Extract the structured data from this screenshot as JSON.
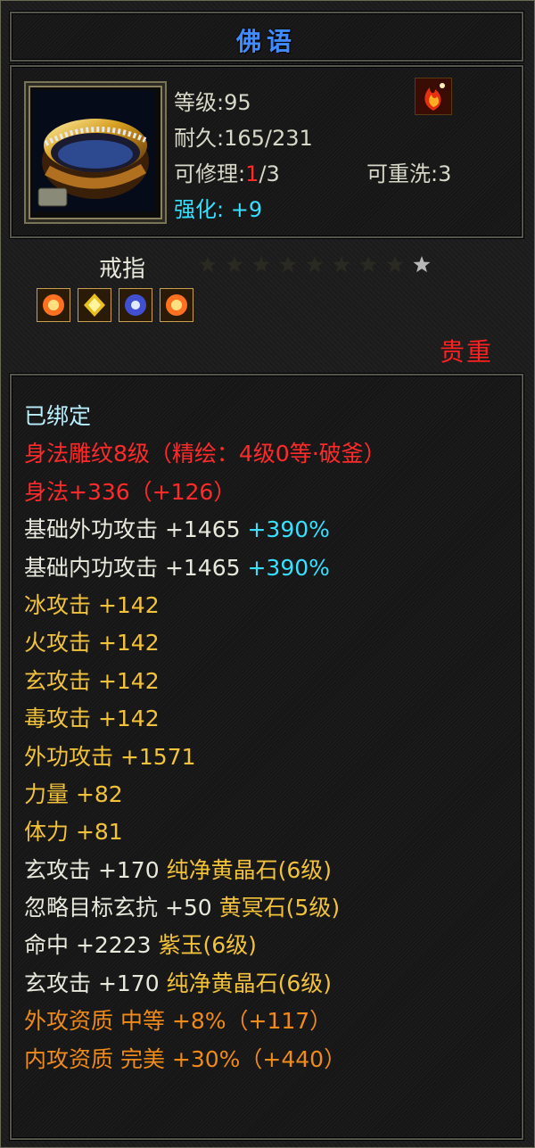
{
  "title": "佛语",
  "info": {
    "level": "等级:95",
    "durability": "耐久:165/231",
    "repair_label": "可修理:",
    "repair_used": "1",
    "repair_total": "/3",
    "rewash": "可重洗:3",
    "enhance_label": "强化:",
    "enhance_value": "+9"
  },
  "item_type": "戒指",
  "stars": {
    "filled": 8,
    "total": 9
  },
  "gems": [
    "fire-gem-icon",
    "gold-gem-icon",
    "blue-gem-icon",
    "fire-gem-icon"
  ],
  "rarity": "贵重",
  "attributes": [
    {
      "text": "已绑定",
      "color": "cyanw"
    },
    {
      "text": "身法雕纹8级（精绘：4级0等·破釜）",
      "color": "red"
    },
    {
      "text": "身法+336（+126）",
      "color": "red"
    },
    {
      "text": "基础外功攻击 +1465 ",
      "extra": "+390%",
      "color": "white"
    },
    {
      "text": "基础内功攻击 +1465 ",
      "extra": "+390%",
      "color": "white"
    },
    {
      "text": "冰攻击 +142",
      "color": "yellow"
    },
    {
      "text": "火攻击 +142",
      "color": "yellow"
    },
    {
      "text": "玄攻击 +142",
      "color": "yellow"
    },
    {
      "text": "毒攻击 +142",
      "color": "yellow"
    },
    {
      "text": "外功攻击 +1571",
      "color": "yellow"
    },
    {
      "text": "力量 +82",
      "color": "yellow"
    },
    {
      "text": "体力 +81",
      "color": "yellow"
    },
    {
      "text": "玄攻击 +170 ",
      "extra": "纯净黄晶石(6级)",
      "color": "white",
      "extra_color": "gold"
    },
    {
      "text": "忽略目标玄抗 +50 ",
      "extra": "黄冥石(5级)",
      "color": "white",
      "extra_color": "gold"
    },
    {
      "text": "命中 +2223 ",
      "extra": "紫玉(6级)",
      "color": "white",
      "extra_color": "gold"
    },
    {
      "text": "玄攻击 +170 ",
      "extra": "纯净黄晶石(6级)",
      "color": "white",
      "extra_color": "gold"
    },
    {
      "text": "外攻资质  中等 +8%（+117）",
      "color": "orange"
    },
    {
      "text": "内攻资质  完美 +30%（+440）",
      "color": "orange"
    }
  ]
}
